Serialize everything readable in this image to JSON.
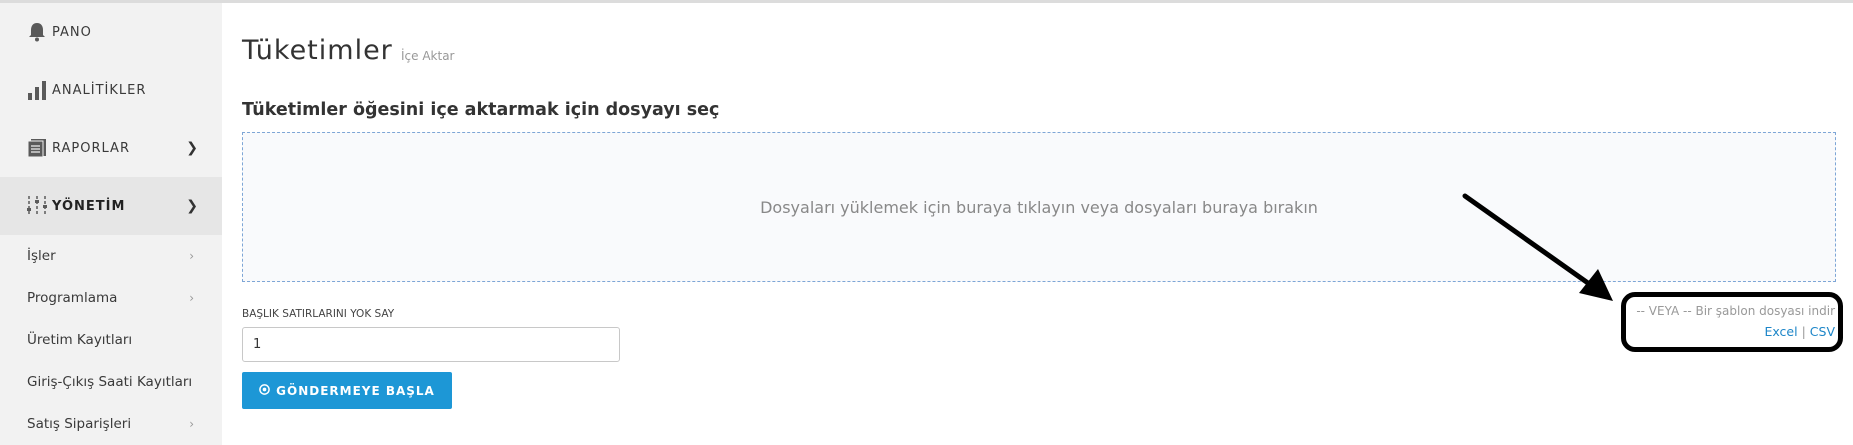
{
  "sidebar": {
    "main_items": [
      {
        "label": "PANO",
        "icon": "bell-icon"
      },
      {
        "label": "ANALİTİKLER",
        "icon": "bar-chart-icon"
      },
      {
        "label": "RAPORLAR",
        "icon": "document-stack-icon"
      },
      {
        "label": "YÖNETİM",
        "icon": "sliders-icon"
      }
    ],
    "sub_items": [
      {
        "label": "İşler"
      },
      {
        "label": "Programlama"
      },
      {
        "label": "Üretim Kayıtları"
      },
      {
        "label": "Giriş-Çıkış Saati Kayıtları"
      },
      {
        "label": "Satış Siparişleri"
      }
    ]
  },
  "main": {
    "title": "Tüketimler",
    "subtitle": "İçe Aktar",
    "section_heading": "Tüketimler öğesini içe aktarmak için dosyayı seç",
    "dropzone_text": "Dosyaları yüklemek için buraya tıklayın veya dosyaları buraya bırakın",
    "header_rows_label": "BAŞLIK SATIRLARINI YOK SAY",
    "header_rows_value": "1",
    "submit_label": "GÖNDERMEYE BAŞLA",
    "template_text": "-- VEYA -- Bir şablon dosyası indir",
    "template_excel": "Excel",
    "template_separator": "|",
    "template_csv": "CSV"
  },
  "colors": {
    "accent": "#1d97d6",
    "link": "#1d86c8",
    "sidebar_bg": "#f2f2f2",
    "annotation": "#000000"
  }
}
